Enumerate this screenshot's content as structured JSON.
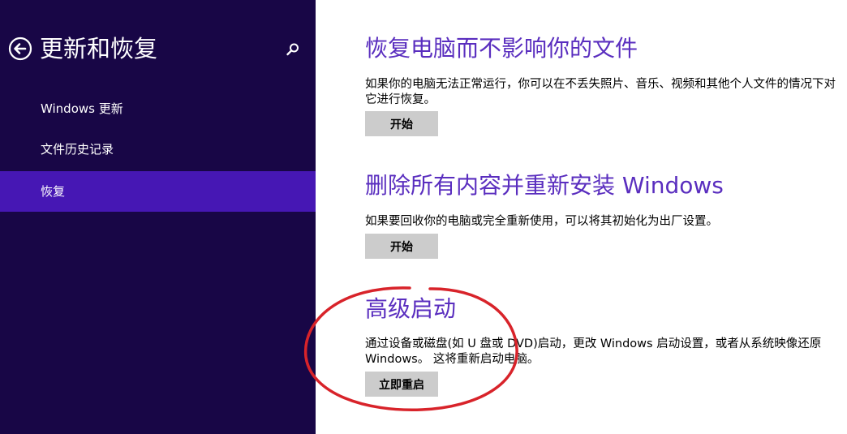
{
  "sidebar": {
    "title": "更新和恢复",
    "back_icon": "back-arrow-icon",
    "search_icon": "search-icon",
    "items": [
      {
        "label": "Windows 更新"
      },
      {
        "label": "文件历史记录"
      },
      {
        "label": "恢复",
        "selected": true
      }
    ]
  },
  "main": {
    "sections": [
      {
        "title": "恢复电脑而不影响你的文件",
        "description": "如果你的电脑无法正常运行，你可以在不丢失照片、音乐、视频和其他个人文件的情况下对它进行恢复。",
        "button_label": "开始"
      },
      {
        "title": "删除所有内容并重新安装 Windows",
        "description": "如果要回收你的电脑或完全重新使用，可以将其初始化为出厂设置。",
        "button_label": "开始"
      },
      {
        "title": "高级启动",
        "description": "通过设备或磁盘(如 U 盘或 DVD)启动，更改 Windows 启动设置，或者从系统映像还原 Windows。 这将重新启动电脑。",
        "button_label": "立即重启"
      }
    ]
  },
  "colors": {
    "sidebar_bg": "#180646",
    "sidebar_selected": "#4617b4",
    "title_accent": "#5a2ebf",
    "button_bg": "#cccccc",
    "annotation": "#d8232a"
  }
}
